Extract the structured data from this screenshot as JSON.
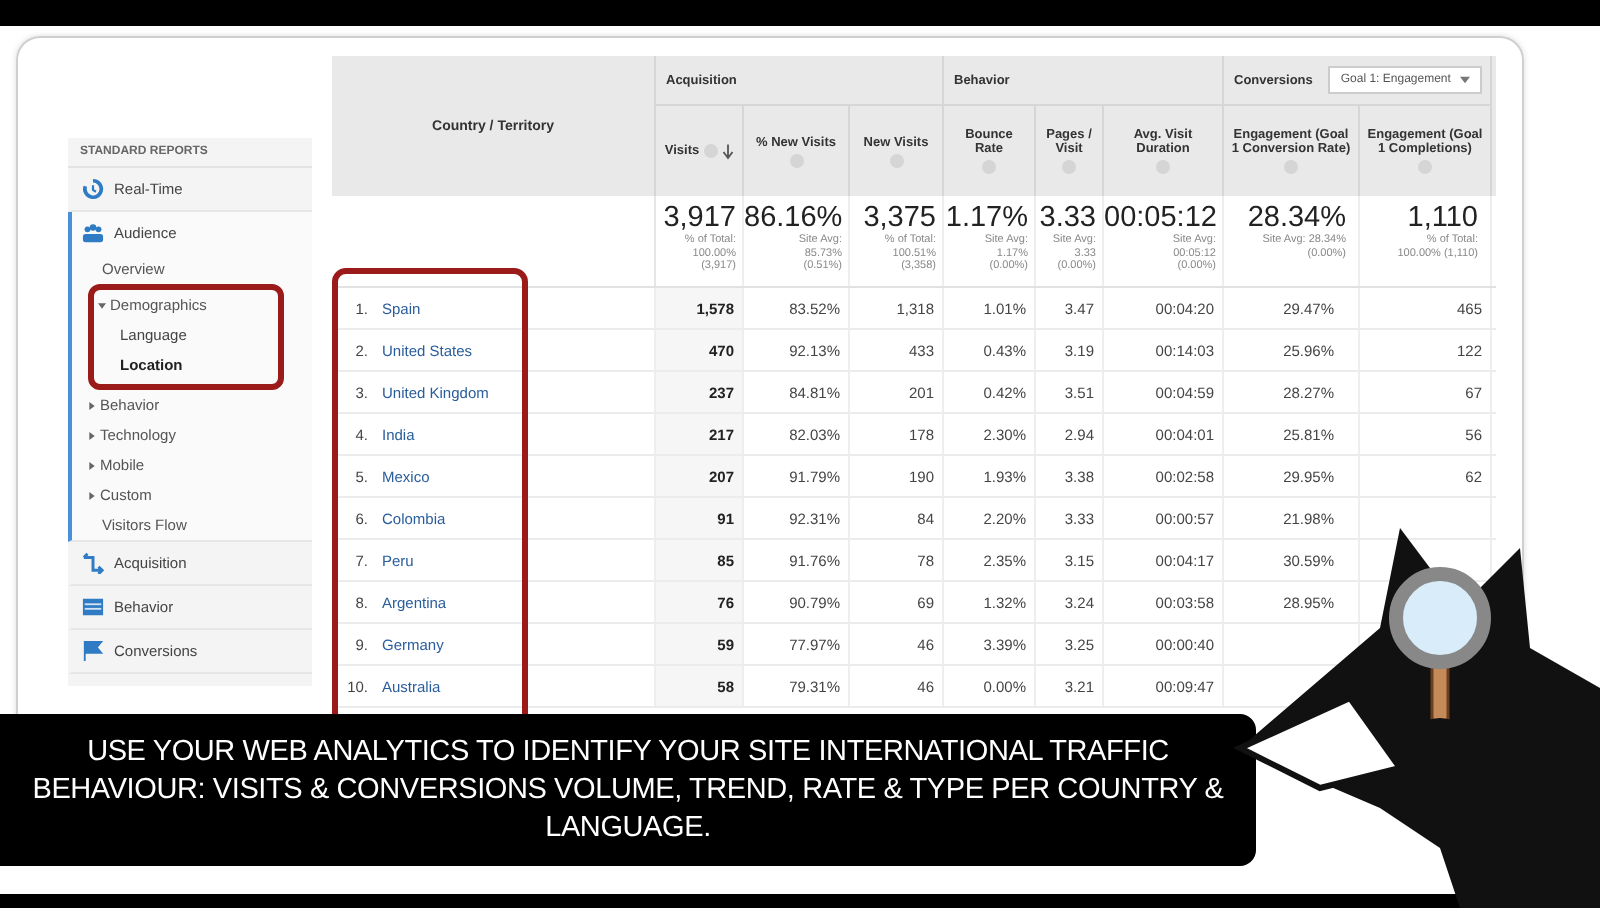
{
  "sidebar": {
    "heading": "STANDARD REPORTS",
    "sections": [
      {
        "label": "Real-Time",
        "kind": "clock",
        "expanded": false
      },
      {
        "label": "Audience",
        "kind": "people",
        "expanded": true,
        "children": [
          {
            "label": "Overview",
            "kind": "page"
          },
          {
            "label": "Demographics",
            "kind": "folder",
            "expanded": true,
            "highlighted": true,
            "children": [
              {
                "label": "Language",
                "selected": false
              },
              {
                "label": "Location",
                "selected": true
              }
            ]
          },
          {
            "label": "Behavior",
            "kind": "folder",
            "expanded": false,
            "highlighted": false
          },
          {
            "label": "Technology",
            "kind": "folder",
            "expanded": false,
            "highlighted": false
          },
          {
            "label": "Mobile",
            "kind": "folder",
            "expanded": false,
            "highlighted": false
          },
          {
            "label": "Custom",
            "kind": "folder",
            "expanded": false,
            "highlighted": false
          },
          {
            "label": "Visitors Flow",
            "kind": "page"
          }
        ]
      },
      {
        "label": "Acquisition",
        "kind": "arrows",
        "expanded": false
      },
      {
        "label": "Behavior",
        "kind": "page",
        "expanded": false
      },
      {
        "label": "Conversions",
        "kind": "flag",
        "expanded": false
      }
    ]
  },
  "table": {
    "first_column": "Country / Territory",
    "first_column_highlighted": true,
    "groups": [
      {
        "label": "Acquisition",
        "columns": [
          {
            "label": "Visits",
            "sorted": true
          },
          {
            "label": "% New Visits",
            "sorted": false
          },
          {
            "label": "New Visits",
            "sorted": false
          }
        ]
      },
      {
        "label": "Behavior",
        "columns": [
          {
            "label": "Bounce Rate",
            "sorted": false
          },
          {
            "label": "Pages / Visit",
            "sorted": false
          },
          {
            "label": "Avg. Visit Duration",
            "sorted": false
          }
        ]
      },
      {
        "label": "Conversions",
        "goal_selector": "Goal 1: Engagement",
        "columns": [
          {
            "label": "Engagement (Goal 1 Conversion Rate)",
            "sorted": false
          },
          {
            "label": "Engagement (Goal 1 Completions)",
            "sorted": false
          }
        ]
      }
    ],
    "totals": [
      {
        "value": "3,917",
        "sub": [
          "% of Total:",
          "100.00%",
          "(3,917)"
        ]
      },
      {
        "value": "86.16%",
        "sub": [
          "Site Avg:",
          "85.73%",
          "(0.51%)"
        ]
      },
      {
        "value": "3,375",
        "sub": [
          "% of Total:",
          "100.51%",
          "(3,358)"
        ]
      },
      {
        "value": "1.17%",
        "sub": [
          "Site Avg:",
          "1.17%",
          "(0.00%)"
        ]
      },
      {
        "value": "3.33",
        "sub": [
          "Site Avg:",
          "3.33",
          "(0.00%)"
        ]
      },
      {
        "value": "00:05:12",
        "sub": [
          "Site Avg:",
          "00:05:12",
          "(0.00%)"
        ]
      },
      {
        "value": "28.34%",
        "sub": [
          "Site Avg: 28.34%",
          "(0.00%)"
        ]
      },
      {
        "value": "1,110",
        "sub": [
          "% of Total:",
          "100.00% (1,110)"
        ]
      }
    ],
    "rows": [
      {
        "rank": "1.",
        "country": "Spain",
        "values": [
          "1,578",
          "83.52%",
          "1,318",
          "1.01%",
          "3.47",
          "00:04:20",
          "29.47%",
          "465"
        ]
      },
      {
        "rank": "2.",
        "country": "United States",
        "values": [
          "470",
          "92.13%",
          "433",
          "0.43%",
          "3.19",
          "00:14:03",
          "25.96%",
          "122"
        ]
      },
      {
        "rank": "3.",
        "country": "United Kingdom",
        "values": [
          "237",
          "84.81%",
          "201",
          "0.42%",
          "3.51",
          "00:04:59",
          "28.27%",
          "67"
        ]
      },
      {
        "rank": "4.",
        "country": "India",
        "values": [
          "217",
          "82.03%",
          "178",
          "2.30%",
          "2.94",
          "00:04:01",
          "25.81%",
          "56"
        ]
      },
      {
        "rank": "5.",
        "country": "Mexico",
        "values": [
          "207",
          "91.79%",
          "190",
          "1.93%",
          "3.38",
          "00:02:58",
          "29.95%",
          "62"
        ]
      },
      {
        "rank": "6.",
        "country": "Colombia",
        "values": [
          "91",
          "92.31%",
          "84",
          "2.20%",
          "3.33",
          "00:00:57",
          "21.98%"
        ]
      },
      {
        "rank": "7.",
        "country": "Peru",
        "values": [
          "85",
          "91.76%",
          "78",
          "2.35%",
          "3.15",
          "00:04:17",
          "30.59%"
        ]
      },
      {
        "rank": "8.",
        "country": "Argentina",
        "values": [
          "76",
          "90.79%",
          "69",
          "1.32%",
          "3.24",
          "00:03:58",
          "28.95%"
        ]
      },
      {
        "rank": "9.",
        "country": "Germany",
        "values": [
          "59",
          "77.97%",
          "46",
          "3.39%",
          "3.25",
          "00:00:40"
        ]
      },
      {
        "rank": "10.",
        "country": "Australia",
        "values": [
          "58",
          "79.31%",
          "46",
          "0.00%",
          "3.21",
          "00:09:47"
        ]
      }
    ]
  },
  "caption": "USE YOUR WEB ANALYTICS TO IDENTIFY YOUR SITE INTERNATIONAL TRAFFIC BEHAVIOUR:  VISITS & CONVERSIONS VOLUME, TREND, RATE & TYPE PER COUNTRY & LANGUAGE."
}
